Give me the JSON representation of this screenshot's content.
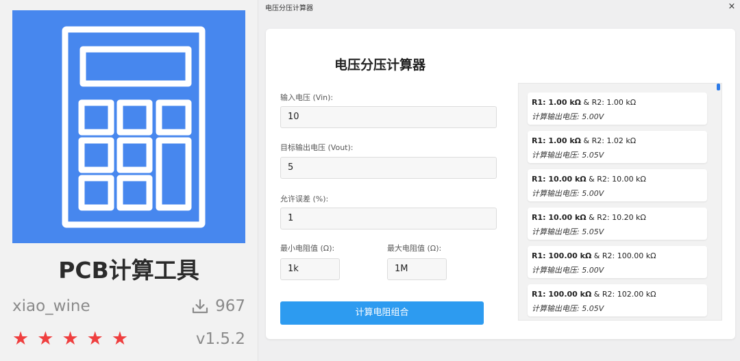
{
  "store": {
    "app_name": "PCB计算工具",
    "author": "xiao_wine",
    "downloads": "967",
    "rating_stars": 5,
    "version": "v1.5.2",
    "icon_bg": "#4787ee",
    "star_color": "#ef3f3f"
  },
  "window": {
    "title": "电压分压计算器",
    "close": "×"
  },
  "form": {
    "heading": "电压分压计算器",
    "vin_label": "输入电压 (Vin):",
    "vin_value": "10",
    "vout_label": "目标输出电压 (Vout):",
    "vout_value": "5",
    "tol_label": "允许误差 (%):",
    "tol_value": "1",
    "rmin_label": "最小电阻值 (Ω):",
    "rmin_value": "1k",
    "rmax_label": "最大电阻值 (Ω):",
    "rmax_value": "1M",
    "calc_button": "计算电阻组合",
    "accent": "#2d9bf0"
  },
  "results": [
    {
      "r1": "R1: 1.00 kΩ",
      "r2": " & R2: 1.00 kΩ",
      "vout": "计算输出电压: 5.00V"
    },
    {
      "r1": "R1: 1.00 kΩ",
      "r2": " & R2: 1.02 kΩ",
      "vout": "计算输出电压: 5.05V"
    },
    {
      "r1": "R1: 10.00 kΩ",
      "r2": " & R2: 10.00 kΩ",
      "vout": "计算输出电压: 5.00V"
    },
    {
      "r1": "R1: 10.00 kΩ",
      "r2": " & R2: 10.20 kΩ",
      "vout": "计算输出电压: 5.05V"
    },
    {
      "r1": "R1: 100.00 kΩ",
      "r2": " & R2: 100.00 kΩ",
      "vout": "计算输出电压: 5.00V"
    },
    {
      "r1": "R1: 100.00 kΩ",
      "r2": " & R2: 102.00 kΩ",
      "vout": "计算输出电压: 5.05V"
    }
  ]
}
